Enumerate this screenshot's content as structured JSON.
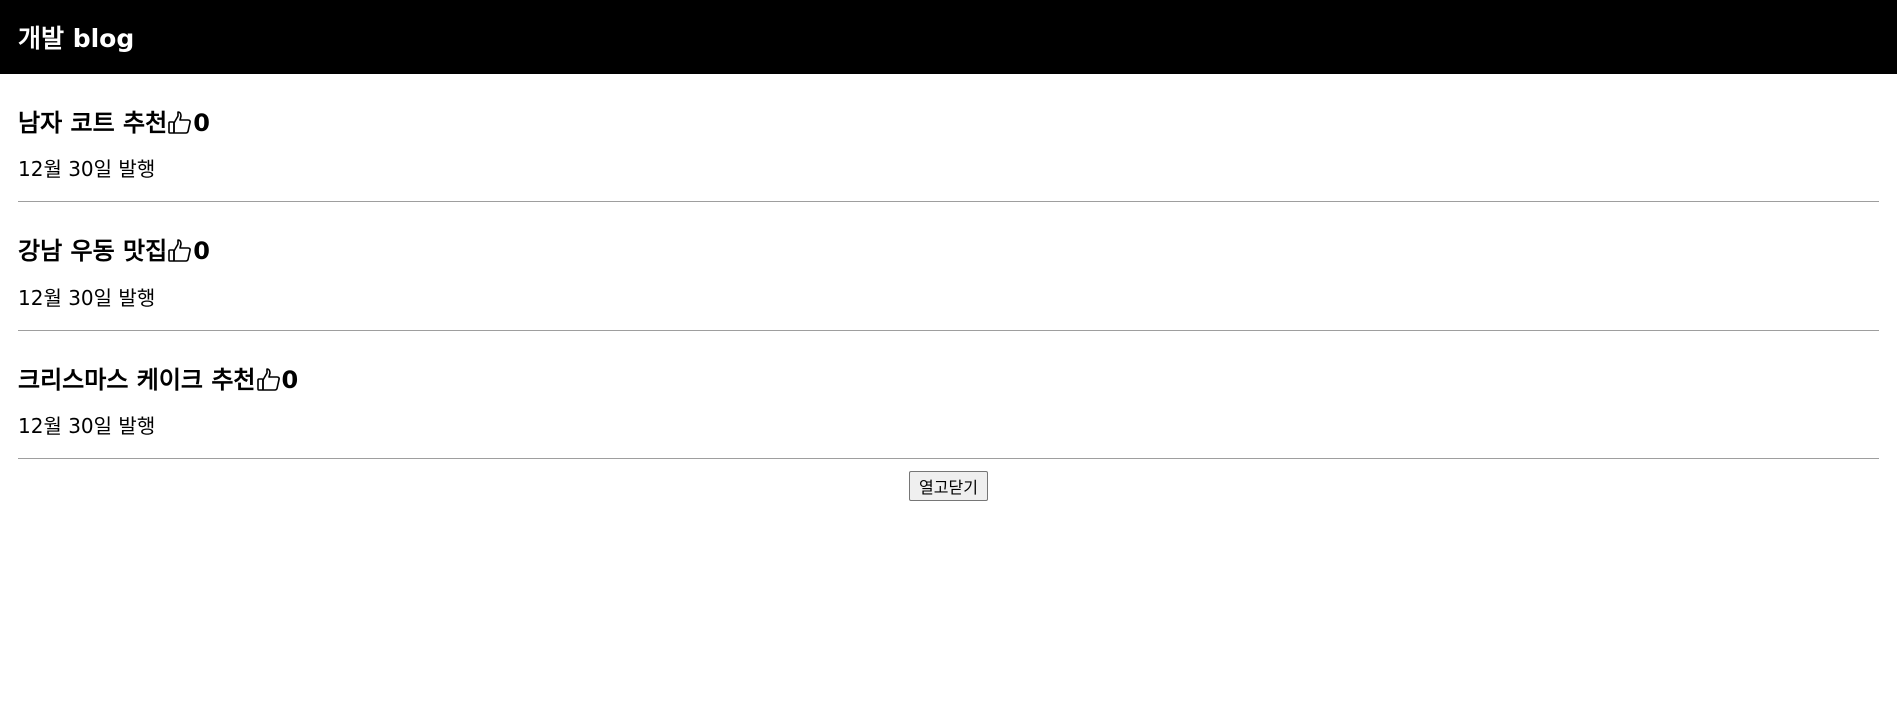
{
  "nav": {
    "title": "개발 blog"
  },
  "posts": [
    {
      "title": "남자 코트 추천",
      "icon": "thumbs-up-icon",
      "likes": "0",
      "date": "12월 30일 발행"
    },
    {
      "title": "강남 우동 맛집",
      "icon": "thumbs-up-icon",
      "likes": "0",
      "date": "12월 30일 발행"
    },
    {
      "title": "크리스마스 케이크 추천",
      "icon": "thumbs-up-icon",
      "likes": "0",
      "date": "12월 30일 발행"
    }
  ],
  "toggle_button": {
    "label": "열고닫기"
  }
}
